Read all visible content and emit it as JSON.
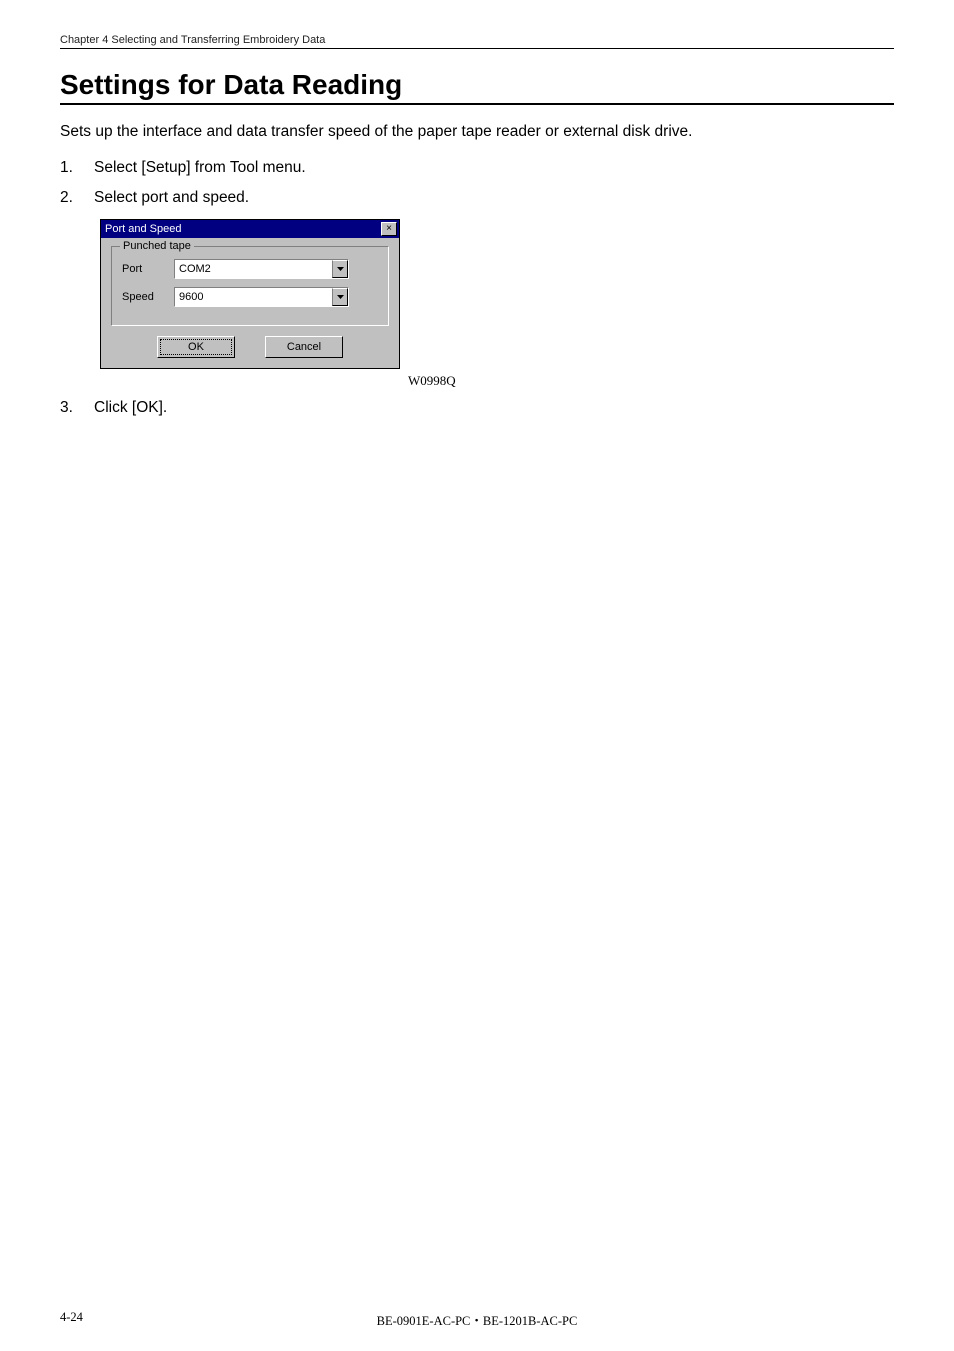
{
  "header": {
    "running": "Chapter 4    Selecting and Transferring Embroidery Data"
  },
  "title": "Settings for Data Reading",
  "intro": "Sets up the interface and data transfer speed of the paper tape reader or external disk drive.",
  "steps": {
    "s1_num": "1.",
    "s1_text": "Select [Setup] from Tool menu.",
    "s2_num": "2.",
    "s2_text": "Select port and speed.",
    "s3_num": "3.",
    "s3_text": "Click [OK]."
  },
  "dialog": {
    "title": "Port and Speed",
    "close_glyph": "×",
    "group_legend": "Punched tape",
    "port_label": "Port",
    "port_value": "COM2",
    "speed_label": "Speed",
    "speed_value": "9600",
    "ok_label": "OK",
    "cancel_label": "Cancel"
  },
  "figure_ref": "W0998Q",
  "footer": {
    "page": "4-24",
    "model": "BE-0901E-AC-PC・BE-1201B-AC-PC"
  }
}
